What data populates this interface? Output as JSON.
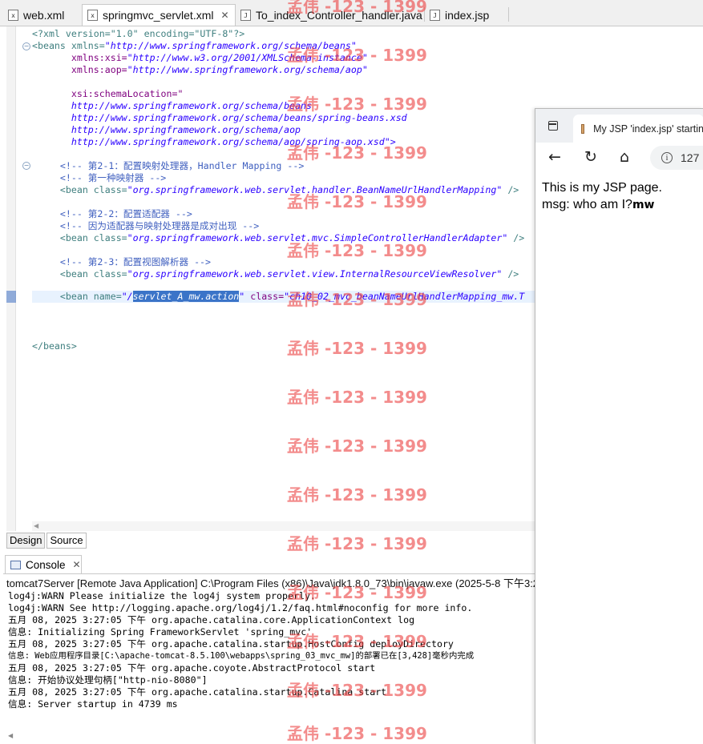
{
  "tabs": [
    {
      "label": "web.xml",
      "icon": "xml-file-icon"
    },
    {
      "label": "springmvc_servlet.xml",
      "icon": "xml-file-icon",
      "active": true
    },
    {
      "label": "To_index_Controller_handler.java",
      "icon": "java-file-icon"
    },
    {
      "label": "index.jsp",
      "icon": "jsp-file-icon"
    }
  ],
  "editor": {
    "lines": {
      "l1": "<?xml version=\"1.0\" encoding=\"UTF-8\"?>",
      "l2a": "<beans xmlns=",
      "l2b": "\"http://www.springframework.org/schema/beans\"",
      "l3a": "       xmlns:xsi=",
      "l3b": "\"http://www.w3.org/2001/XMLSchema-instance\"",
      "l4a": "       xmlns:aop=",
      "l4b": "\"http://www.springframework.org/schema/aop\"",
      "l5": "       xsi:schemaLocation=\"",
      "l6": "       http://www.springframework.org/schema/beans",
      "l7": "       http://www.springframework.org/schema/beans/spring-beans.xsd",
      "l8": "       http://www.springframework.org/schema/aop",
      "l9": "       http://www.springframework.org/schema/aop/spring-aop.xsd\">",
      "c1": "     <!-- 第2-1：配置映射处理器，Handler Mapping -->",
      "c2": "     <!-- 第一种映射器 -->",
      "b1a": "     <bean class=",
      "b1b": "\"org.springframework.web.servlet.handler.BeanNameUrlHandlerMapping\"",
      "b1c": " />",
      "c3": "     <!-- 第2-2：配置适配器 -->",
      "c4": "     <!-- 因为适配器与映射处理器是成对出现 -->",
      "b2a": "     <bean class=",
      "b2b": "\"org.springframework.web.servlet.mvc.SimpleControllerHandlerAdapter\"",
      "b2c": " />",
      "c5": "     <!-- 第2-3：配置视图解析器 -->",
      "b3a": "     <bean class=",
      "b3b": "\"org.springframework.web.servlet.view.InternalResourceViewResolver\"",
      "b3c": " />",
      "b4a": "     <bean name=",
      "b4b": "\"/",
      "b4sel": "servlet_A_mw.action",
      "b4c": "\"",
      "b4d": " class=",
      "b4e": "\"ch10_02_mvc_beanNameUrlHandlerMapping_mw.T",
      "end": "</beans>"
    }
  },
  "bottom_tabs": {
    "design": "Design",
    "source": "Source"
  },
  "console": {
    "tab_label": "Console",
    "header": "tomcat7Server [Remote Java Application] C:\\Program Files (x86)\\Java\\jdk1.8.0_73\\bin\\javaw.exe (2025-5-8 下午3:2",
    "lines": [
      "log4j:WARN Please initialize the log4j system properly.",
      "log4j:WARN See http://logging.apache.org/log4j/1.2/faq.html#noconfig for more info.",
      "五月 08, 2025 3:27:05 下午 org.apache.catalina.core.ApplicationContext log",
      "信息: Initializing Spring FrameworkServlet 'spring_mvc'",
      "五月 08, 2025 3:27:05 下午 org.apache.catalina.startup.HostConfig deployDirectory",
      "信息: Web应用程序目录[C:\\apache-tomcat-8.5.100\\webapps\\spring_03_mvc_mw]的部署已在[3,428]毫秒内完成",
      "五月 08, 2025 3:27:05 下午 org.apache.coyote.AbstractProtocol start",
      "信息: 开始协议处理句柄[\"http-nio-8080\"]",
      "五月 08, 2025 3:27:05 下午 org.apache.catalina.startup.Catalina start",
      "信息: Server startup in 4739 ms"
    ]
  },
  "browser": {
    "tab_title": "My JSP 'index.jsp' startin",
    "address": "127",
    "content_line1": "This is my JSP page.",
    "content_line2": "msg: who am I?",
    "content_mw": "mw"
  },
  "watermark": "孟伟 -123 - 1399",
  "colors": {
    "tag": "#3f7f7f",
    "attr": "#7f007f",
    "value": "#2a00ff",
    "comment": "#3f5fbf",
    "selection": "#3b74c8",
    "watermark": "#ec4646"
  }
}
